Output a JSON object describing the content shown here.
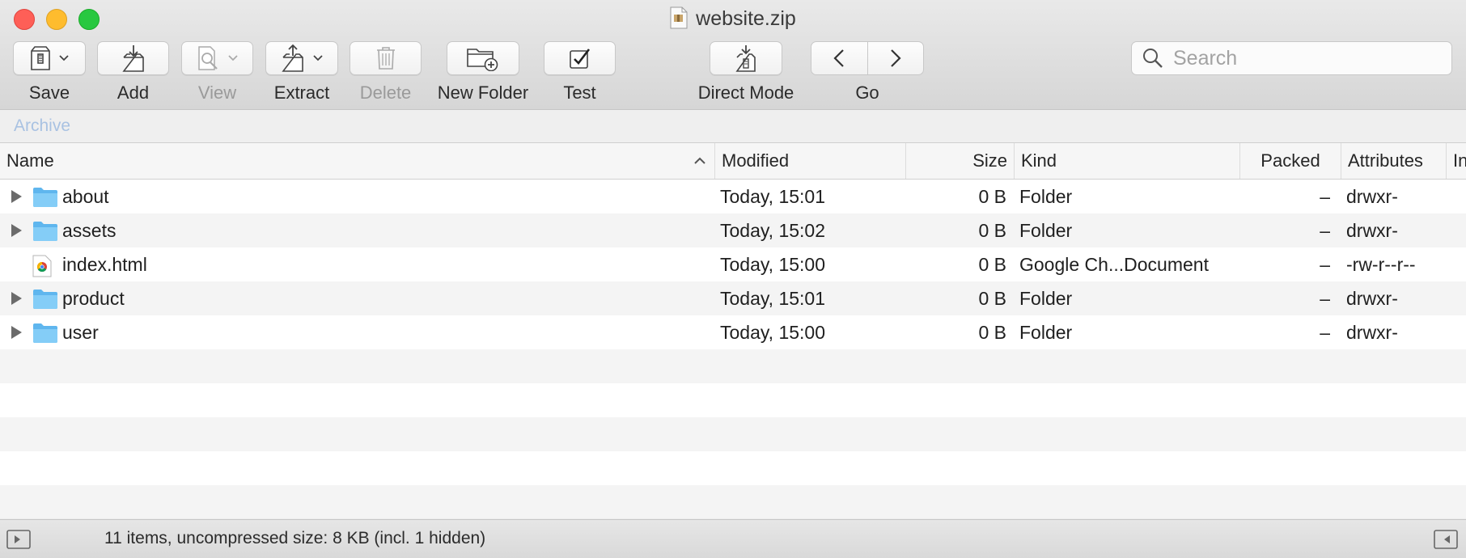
{
  "window": {
    "title": "website.zip"
  },
  "toolbar": {
    "save_label": "Save",
    "add_label": "Add",
    "view_label": "View",
    "extract_label": "Extract",
    "delete_label": "Delete",
    "new_folder_label": "New Folder",
    "test_label": "Test",
    "direct_mode_label": "Direct Mode",
    "go_label": "Go"
  },
  "search": {
    "placeholder": "Search",
    "value": ""
  },
  "pathbar": {
    "label": "Archive"
  },
  "table": {
    "columns": {
      "name": "Name",
      "modified": "Modified",
      "size": "Size",
      "kind": "Kind",
      "packed": "Packed",
      "attributes": "Attributes",
      "extra": "In"
    },
    "rows": [
      {
        "name": "about",
        "modified": "Today, 15:01",
        "size": "0 B",
        "kind": "Folder",
        "packed": "–",
        "attributes": "drwxr-",
        "icon": "folder-icon",
        "expandable": true
      },
      {
        "name": "assets",
        "modified": "Today, 15:02",
        "size": "0 B",
        "kind": "Folder",
        "packed": "–",
        "attributes": "drwxr-",
        "icon": "folder-icon",
        "expandable": true
      },
      {
        "name": "index.html",
        "modified": "Today, 15:00",
        "size": "0 B",
        "kind": "Google Ch...Document",
        "packed": "–",
        "attributes": "-rw-r--r--",
        "icon": "chrome-document-icon",
        "expandable": false
      },
      {
        "name": "product",
        "modified": "Today, 15:01",
        "size": "0 B",
        "kind": "Folder",
        "packed": "–",
        "attributes": "drwxr-",
        "icon": "folder-icon",
        "expandable": true
      },
      {
        "name": "user",
        "modified": "Today, 15:00",
        "size": "0 B",
        "kind": "Folder",
        "packed": "–",
        "attributes": "drwxr-",
        "icon": "folder-icon",
        "expandable": true
      }
    ]
  },
  "status": {
    "text": "11 items, uncompressed size: 8 KB (incl. 1 hidden)"
  },
  "colors": {
    "close": "#fe5f57",
    "minimize": "#febc2e",
    "zoom": "#28c840",
    "folder": "#6ec1f2",
    "pathbar_text": "#a9c2e2"
  }
}
